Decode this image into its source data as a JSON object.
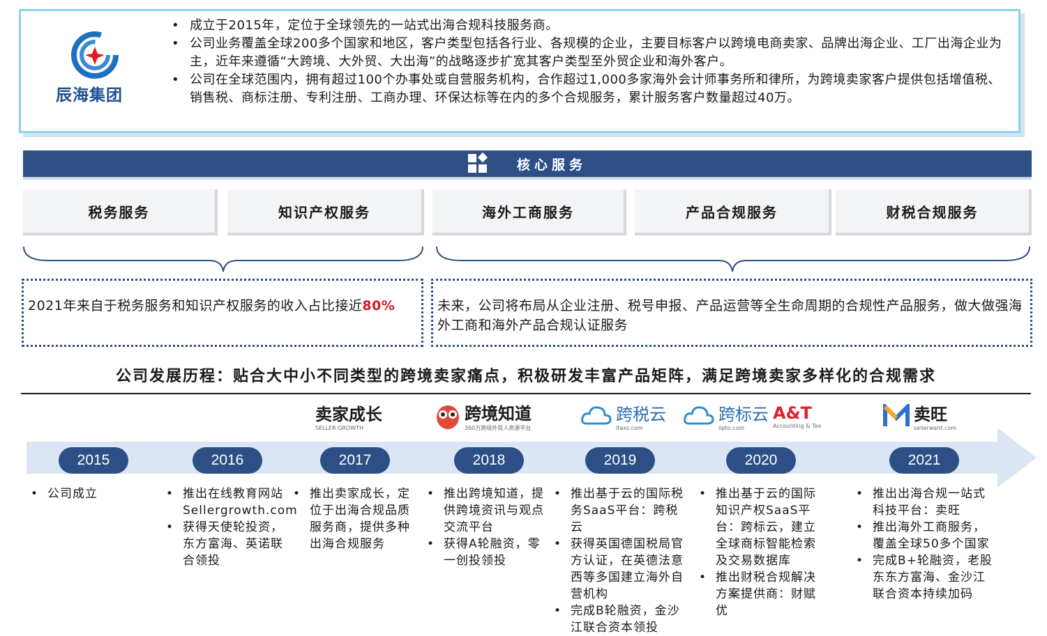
{
  "intro": {
    "logo_text": "辰海集团",
    "bullets": [
      "成立于2015年，定位于全球领先的一站式出海合规科技服务商。",
      "公司业务覆盖全球200多个国家和地区，客户类型包括各行业、各规模的企业，主要目标客户以跨境电商卖家、品牌出海企业、工厂出海企业为主，近年来遵循“大跨境、大外贸、大出海”的战略逐步扩宽其客户类型至外贸企业和海外客户。",
      "公司在全球范围内，拥有超过100个办事处或自营服务机构，合作超过1,000多家海外会计师事务所和律所，为跨境卖家客户提供包括增值税、销售税、商标注册、专利注册、工商办理、环保达标等在内的多个合规服务，累计服务客户数量超过40万。"
    ]
  },
  "core": {
    "title": "核心服务",
    "services": [
      "税务服务",
      "知识产权服务",
      "海外工商服务",
      "产品合规服务",
      "财税合规服务"
    ]
  },
  "notes": {
    "left_text": "2021年来自于税务服务和知识产权服务的收入占比接近",
    "left_highlight": "80%",
    "right_text": "未来，公司将布局从企业注册、税号申报、产品运营等全生命周期的合规性产品服务，做大做强海外工商和海外产品合规认证服务"
  },
  "development": {
    "title": "公司发展历程：贴合大中小不同类型的跨境卖家痛点，积极研发丰富产品矩阵，满足跨境卖家多样化的合规需求",
    "brands": [
      {
        "name": "卖家成长",
        "sub": "SELLER GROWTH"
      },
      {
        "name": "跨境知道",
        "sub": "360万跨境外贸人资源平台"
      },
      {
        "name": "跨税云",
        "sub": "itaxs.com"
      },
      {
        "name": "跨标云",
        "sub": "iipto.com",
        "name2": "A&T",
        "sub2": "Accounting & Tax"
      },
      {
        "name": "卖旺",
        "sub": "sellerwant.com"
      }
    ],
    "milestones": [
      {
        "year": "2015",
        "events": [
          "公司成立"
        ]
      },
      {
        "year": "2016",
        "events": [
          "推出在线教育网站Sellergrowth.com",
          "获得天使轮投资，东方富海、英诺联合领投"
        ]
      },
      {
        "year": "2017",
        "events": [
          "推出卖家成长，定位于出海合规品质服务商，提供多种出海合规服务"
        ]
      },
      {
        "year": "2018",
        "events": [
          "推出跨境知道，提供跨境资讯与观点交流平台",
          "获得A轮融资，零一创投领投"
        ]
      },
      {
        "year": "2019",
        "events": [
          "推出基于云的国际税务SaaS平台：跨税云",
          "获得英国德国税局官方认证，在英德法意西等多国建立海外自营机构",
          "完成B轮融资，金沙江联合资本领投"
        ]
      },
      {
        "year": "2020",
        "events": [
          "推出基于云的国际知识产权SaaS平台：跨标云，建立全球商标智能检索及交易数据库",
          "推出财税合规解决方案提供商：财赋优"
        ]
      },
      {
        "year": "2021",
        "events": [
          "推出出海合规一站式科技平台：卖旺",
          "推出海外工商服务，覆盖全球50多个国家",
          "完成B+轮融资，老股东东方富海、金沙江联合资本持续加码"
        ]
      }
    ]
  },
  "colors": {
    "navy": "#2d4f86",
    "highlight": "#d7191c",
    "timeline": "#dbe6f5"
  }
}
